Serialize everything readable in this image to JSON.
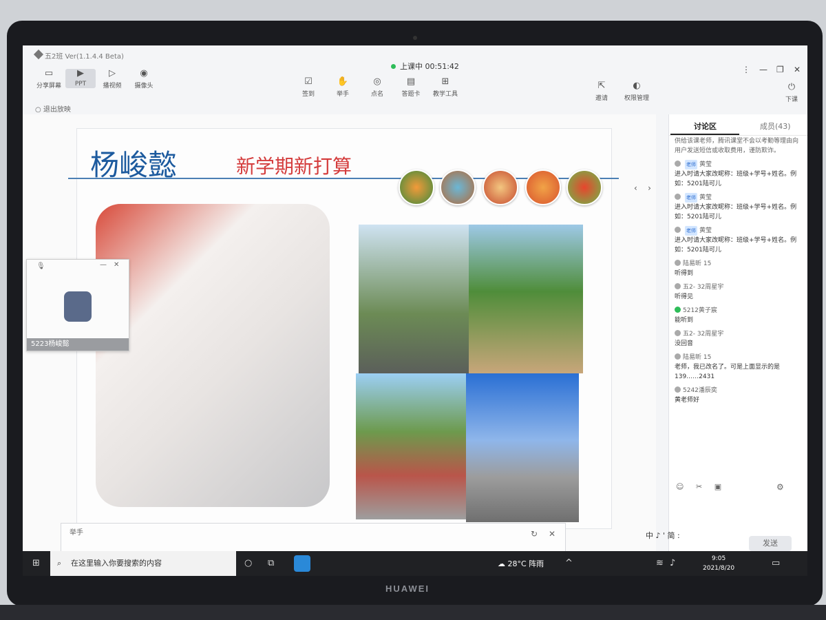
{
  "app": {
    "title": "五2班 Ver(1.1.4.4 Beta)",
    "timer": "上课中 00:51:42",
    "exit_label": "退出放映"
  },
  "left_tools": [
    {
      "label": "分享屏幕",
      "icon": "screen-share-icon"
    },
    {
      "label": "PPT",
      "icon": "ppt-icon"
    },
    {
      "label": "播视频",
      "icon": "video-icon"
    },
    {
      "label": "摄像头",
      "icon": "camera-icon"
    }
  ],
  "center_tools": [
    {
      "label": "签到",
      "icon": "checkin-icon"
    },
    {
      "label": "举手",
      "icon": "hand-icon"
    },
    {
      "label": "点名",
      "icon": "rollcall-icon"
    },
    {
      "label": "答题卡",
      "icon": "answer-card-icon"
    },
    {
      "label": "教学工具",
      "icon": "teaching-tools-icon"
    }
  ],
  "right_tools": [
    {
      "label": "邀请",
      "icon": "invite-icon"
    },
    {
      "label": "权限管理",
      "icon": "permission-icon"
    },
    {
      "label": "下课",
      "icon": "end-class-icon"
    }
  ],
  "slide": {
    "name": "杨峻懿",
    "subtitle": "新学期新打算"
  },
  "mini_video": {
    "name": "5223杨峻懿"
  },
  "raise_hand": {
    "label": "举手"
  },
  "panel": {
    "tab_discuss": "讨论区",
    "tab_members": "成员(43)",
    "notice": "供给该课老师，腾讯课堂不会以考勤等理由向用户发送短信或收取费用，谨防欺诈。",
    "messages": [
      {
        "sender": "黄莹",
        "badge": "老师",
        "text": "进入时请大家改昵称：班级+学号+姓名。例如：5201陆可儿"
      },
      {
        "sender": "黄莹",
        "badge": "老师",
        "text": "进入时请大家改昵称：班级+学号+姓名。例如：5201陆可儿"
      },
      {
        "sender": "黄莹",
        "badge": "老师",
        "text": "进入时请大家改昵称：班级+学号+姓名。例如：5201陆可儿"
      },
      {
        "sender": "陆易昕 15",
        "badge": "",
        "text": "听得到"
      },
      {
        "sender": "五2- 32周星宇",
        "badge": "",
        "text": "听得见"
      },
      {
        "sender": "5212黄子宸",
        "badge": "",
        "text": "能听到"
      },
      {
        "sender": "五2- 32周星宇",
        "badge": "",
        "text": "没回音"
      },
      {
        "sender": "陆易昕 15",
        "badge": "",
        "text": "老师，我已改名了。可是上面显示的是139……2431"
      },
      {
        "sender": "5242潘辰奕",
        "badge": "",
        "text": "黄老师好"
      }
    ],
    "ime": "中 ♪ ' 简 :",
    "send_label": "发送"
  },
  "taskbar": {
    "search_placeholder": "在这里输入你要搜索的内容",
    "weather": "28°C 阵雨",
    "time": "9:05",
    "date": "2021/8/20"
  },
  "device": {
    "brand": "HUAWEI"
  }
}
